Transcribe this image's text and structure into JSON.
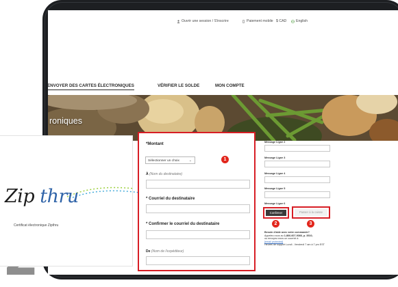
{
  "step_number": "2",
  "topbar": {
    "login_register": "Ouvrir une session / S'inscrire",
    "mobile_payment": "Paiement mobile",
    "currency": "$ CAD",
    "language": "English"
  },
  "nav": {
    "send_cards": "ENVOYER DES CARTES ÉLECTRONIQUES",
    "check_balance": "VÉRIFIER LE SOLDE",
    "my_account": "MON COMPTE"
  },
  "hero": {
    "title": "roniques"
  },
  "card": {
    "logo_zip": "Zip",
    "logo_thru": "thru",
    "caption": "Certificat électronique Zipthru"
  },
  "form": {
    "amount_label": "*Montant",
    "amount_select": "Sélectionner un choix",
    "to_prefix": "À",
    "to_hint": "(Nom du destinataire)",
    "recipient_email_label": "* Courriel du destinataire",
    "confirm_email_label": "* Confirmer le courriel du destinataire",
    "from_prefix": "De",
    "from_hint": "(Nom de l'expéditeur)"
  },
  "message": {
    "line2": "Message Ligne 2",
    "line3": "Message Ligne 3",
    "line4": "Message Ligne 4",
    "line5": "Message Ligne 5",
    "line6": "Message Ligne 6"
  },
  "buttons": {
    "confirm": "Confirmer",
    "pay": "Passer à la caisse"
  },
  "badges": {
    "one": "1",
    "two": "2",
    "three": "3"
  },
  "help": {
    "title": "Besoin d'aide avec votre commande?",
    "call_prefix": "Appelez-nous au",
    "phone": "1-866-607-9366, p. 3510,",
    "email_prefix": "ou envoyez-nous un courriel à",
    "email": "[email protected]",
    "hours": "Heures de support Lundi - Vendredi 7 am à 7 pm EST"
  },
  "colors": {
    "accent": "#d71d24",
    "badge": "#e2261c",
    "logo_blue": "#2f63a8"
  }
}
